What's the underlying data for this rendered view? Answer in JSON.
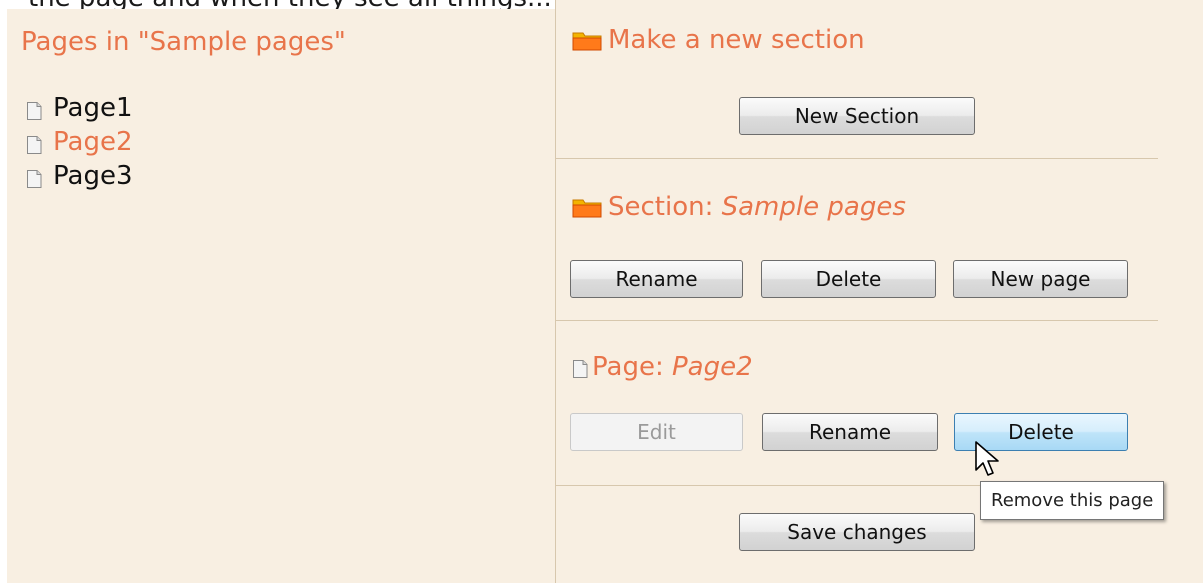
{
  "top_text": "the page and when they see all things...",
  "left": {
    "title": "Pages in \"Sample pages\"",
    "pages": [
      "Page1",
      "Page2",
      "Page3"
    ],
    "selected_page": "Page2"
  },
  "new_section": {
    "heading": "Make a new section",
    "button": "New Section"
  },
  "section": {
    "prefix": "Section: ",
    "name": "Sample pages",
    "rename": "Rename",
    "delete": "Delete",
    "new_page": "New page"
  },
  "page": {
    "prefix": "Page: ",
    "name": "Page2",
    "edit": "Edit",
    "rename": "Rename",
    "delete": "Delete"
  },
  "save_button": "Save changes",
  "tooltip": "Remove this page",
  "colors": {
    "panel_bg": "#f8efe2",
    "accent": "#e8744a",
    "divider": "#d7c7ad"
  },
  "icons": {
    "folder": "folder-icon",
    "document": "document-icon",
    "cursor": "mouse-cursor"
  }
}
